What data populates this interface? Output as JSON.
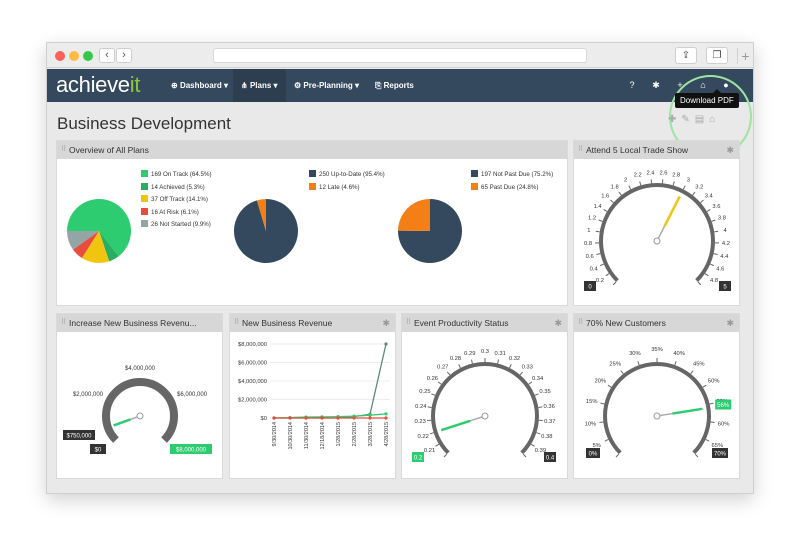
{
  "app": {
    "logo_main": "achieve",
    "logo_accent": "it"
  },
  "nav": {
    "dashboard": "Dashboard",
    "plans": "Plans",
    "preplanning": "Pre-Planning",
    "reports": "Reports"
  },
  "page": {
    "title": "Business Development"
  },
  "tooltip": "Download PDF",
  "panels": {
    "overview": {
      "title": "Overview of All Plans",
      "legend1": [
        "169 On Track (64.5%)",
        "14 Achieved (5.3%)",
        "37 Off Track (14.1%)",
        "16 At Risk (6.1%)",
        "26 Not Started (9.9%)"
      ],
      "legend2": [
        "250 Up-to-Date (95.4%)",
        "12 Late (4.6%)"
      ],
      "legend3": [
        "197 Not Past Due (75.2%)",
        "65 Past Due (24.8%)"
      ]
    },
    "trade": {
      "title": "Attend 5 Local Trade Show",
      "min": "0",
      "max": "5",
      "value": "3",
      "value_label": "3"
    },
    "increase": {
      "title": "Increase New Business Revenu...",
      "ticks": [
        "$2,000,000",
        "$4,000,000",
        "$6,000,000"
      ],
      "min": "$0",
      "max": "$8,000,000",
      "start": "$750,000"
    },
    "newbiz": {
      "title": "New Business Revenue"
    },
    "event": {
      "title": "Event Productivity Status",
      "min": "0.2",
      "max": "0.4"
    },
    "customers": {
      "title": "70% New Customers",
      "min": "0%",
      "max": "70%",
      "value": "56%"
    }
  },
  "colors": {
    "nav": "#35495e",
    "green": "#2ecc71",
    "yellow": "#f1c40f",
    "orange": "#f57f17",
    "red": "#e74c3c",
    "gray": "#95a5a6",
    "navy": "#34495e"
  },
  "chart_data": [
    {
      "type": "pie",
      "title": "",
      "values": [
        169,
        14,
        37,
        16,
        26
      ],
      "labels": [
        "On Track",
        "Achieved",
        "Off Track",
        "At Risk",
        "Not Started"
      ]
    },
    {
      "type": "pie",
      "title": "",
      "values": [
        250,
        12
      ],
      "labels": [
        "Up-to-Date",
        "Late"
      ]
    },
    {
      "type": "pie",
      "title": "",
      "values": [
        197,
        65
      ],
      "labels": [
        "Not Past Due",
        "Past Due"
      ]
    },
    {
      "type": "line",
      "title": "",
      "x": [
        "9/30/2014",
        "10/30/2014",
        "11/30/2014",
        "12/18/2014",
        "1/28/2015",
        "2/28/2015",
        "3/28/2015",
        "4/28/2015"
      ],
      "yticks": [
        "$0",
        "$2,000,000",
        "$4,000,000",
        "$6,000,000",
        "$8,000,000"
      ],
      "ylim": [
        0,
        8000000
      ],
      "series": [
        {
          "values": [
            0,
            0,
            0,
            0,
            0,
            150000,
            400000,
            8000000
          ]
        },
        {
          "values": [
            0,
            50000,
            100000,
            120000,
            150000,
            200000,
            300000,
            450000
          ]
        },
        {
          "values": [
            0,
            0,
            0,
            0,
            0,
            0,
            0,
            0
          ]
        }
      ]
    }
  ],
  "gauge_ticks": {
    "trade": [
      "0",
      "0.2",
      "0.4",
      "0.6",
      "0.8",
      "1",
      "1.2",
      "1.4",
      "1.6",
      "1.8",
      "2",
      "2.2",
      "2.4",
      "2.6",
      "2.8",
      "3",
      "3.2",
      "3.4",
      "3.6",
      "3.8",
      "4",
      "4.2",
      "4.4",
      "4.6",
      "4.8",
      "5"
    ],
    "event": [
      "0.2",
      "0.21",
      "0.22",
      "0.23",
      "0.24",
      "0.25",
      "0.26",
      "0.27",
      "0.28",
      "0.29",
      "0.3",
      "0.31",
      "0.32",
      "0.33",
      "0.34",
      "0.35",
      "0.36",
      "0.37",
      "0.38",
      "0.39",
      "0.4"
    ],
    "customers": [
      "0%",
      "5%",
      "10%",
      "15%",
      "20%",
      "25%",
      "30%",
      "35%",
      "40%",
      "45%",
      "50%",
      "55%",
      "60%",
      "65%",
      "70%"
    ]
  },
  "gauge_values": {
    "trade": 3,
    "increase": 750000,
    "event": 0.22,
    "customers": 56
  }
}
